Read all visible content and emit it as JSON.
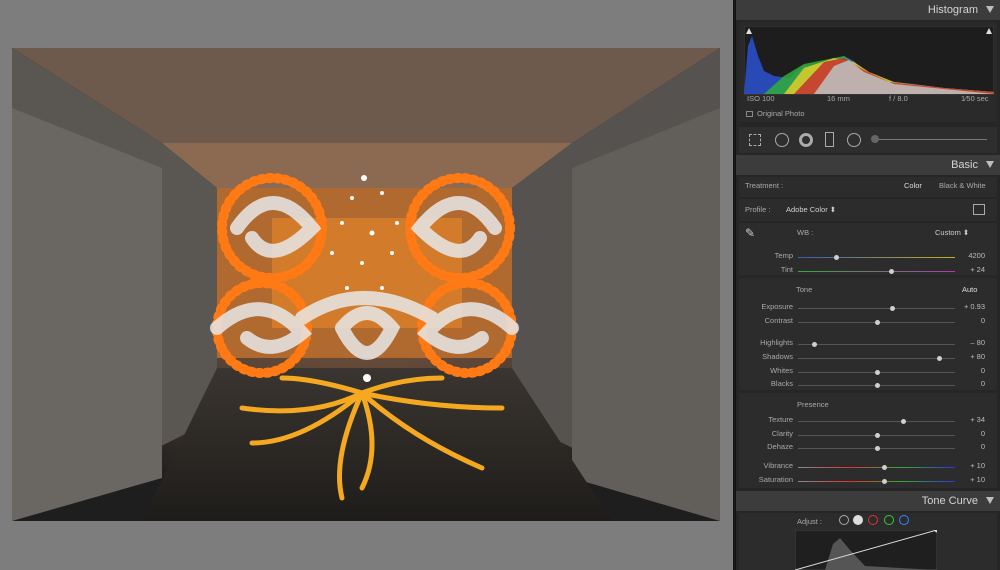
{
  "histogram": {
    "title": "Histogram",
    "iso": "ISO 100",
    "focal": "16 mm",
    "aperture": "f / 8.0",
    "shutter": "1⁄50 sec",
    "original_photo": "Original Photo"
  },
  "basic": {
    "title": "Basic",
    "treatment_label": "Treatment :",
    "color": "Color",
    "bw": "Black & White",
    "profile_label": "Profile :",
    "profile_value": "Adobe Color ⬍",
    "wb_label": "WB :",
    "wb_value": "Custom ⬍",
    "tone_label": "Tone",
    "auto": "Auto",
    "presence_label": "Presence",
    "sliders": [
      {
        "name": "temp",
        "label": "Temp",
        "value": "4200",
        "pos": 0.24
      },
      {
        "name": "tint",
        "label": "Tint",
        "value": "+ 24",
        "pos": 0.59
      },
      {
        "name": "exposure",
        "label": "Exposure",
        "value": "+ 0.93",
        "pos": 0.6
      },
      {
        "name": "contrast",
        "label": "Contrast",
        "value": "0",
        "pos": 0.5
      },
      {
        "name": "highlights",
        "label": "Highlights",
        "value": "– 80",
        "pos": 0.1
      },
      {
        "name": "shadows",
        "label": "Shadows",
        "value": "+ 80",
        "pos": 0.9
      },
      {
        "name": "whites",
        "label": "Whites",
        "value": "0",
        "pos": 0.5
      },
      {
        "name": "blacks",
        "label": "Blacks",
        "value": "0",
        "pos": 0.5
      },
      {
        "name": "texture",
        "label": "Texture",
        "value": "+ 34",
        "pos": 0.67
      },
      {
        "name": "clarity",
        "label": "Clarity",
        "value": "0",
        "pos": 0.5
      },
      {
        "name": "dehaze",
        "label": "Dehaze",
        "value": "0",
        "pos": 0.5
      },
      {
        "name": "vibrance",
        "label": "Vibrance",
        "value": "+ 10",
        "pos": 0.55
      },
      {
        "name": "saturation",
        "label": "Saturation",
        "value": "+ 10",
        "pos": 0.55
      }
    ]
  },
  "tone_curve": {
    "title": "Tone Curve",
    "adjust_label": "Adjust :"
  },
  "colors": {
    "panel_bg": "#262626",
    "header_bg": "#3c3c3c",
    "accent_orange": "#ff7a14"
  }
}
